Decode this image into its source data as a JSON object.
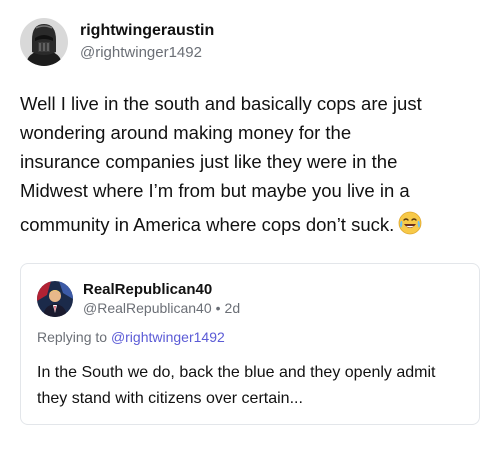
{
  "post": {
    "author": {
      "display_name": "rightwingeraustin",
      "handle": "@rightwinger1492"
    },
    "text_lines": [
      "Well I live in the south and basically cops are just",
      "wondering around making money for the",
      "insurance companies just like they were in the",
      "Midwest where I’m from but maybe you live in a",
      "community in America where cops don’t suck."
    ],
    "trailing_emoji": "laughing-crying-emoji"
  },
  "quoted_post": {
    "author": {
      "display_name": "RealRepublican40",
      "handle": "@RealRepublican40",
      "separator": "•",
      "age": "2d"
    },
    "reply_prefix": "Replying to",
    "reply_handle": "@rightwinger1492",
    "text": "In the South we do, back the blue and they openly admit they stand with citizens over certain..."
  },
  "colors": {
    "link": "#5b5bd6",
    "muted": "#6b6f76",
    "border": "#e3e6ea"
  }
}
